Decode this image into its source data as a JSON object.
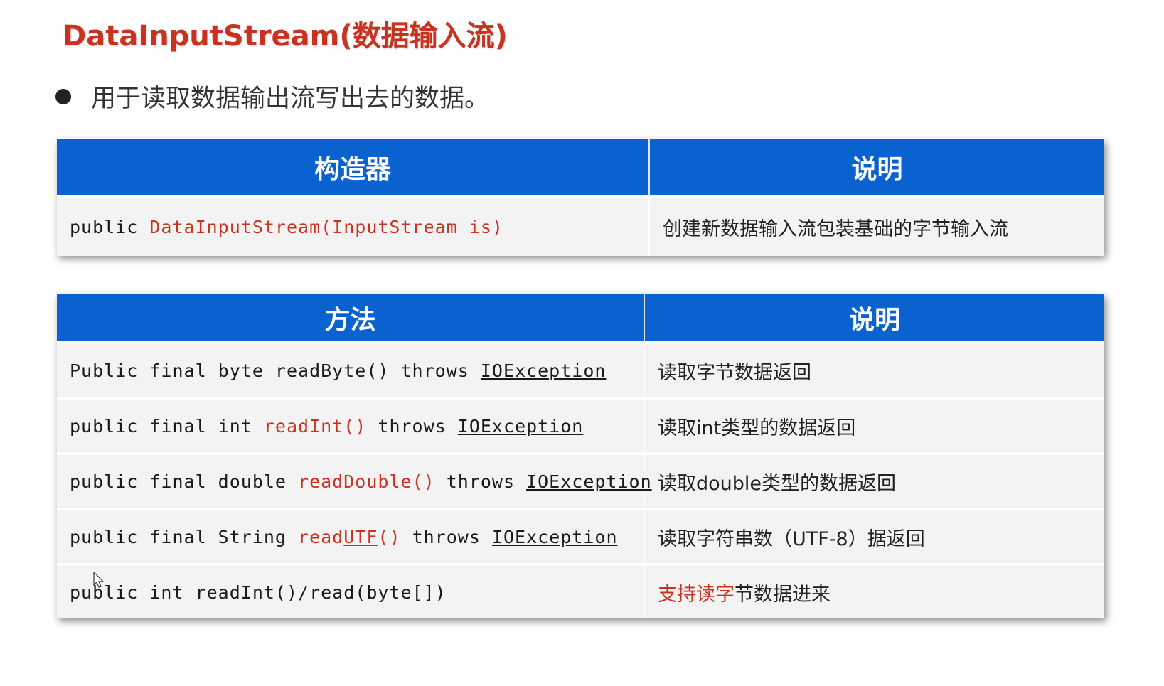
{
  "title": "DataInputStream(数据输入流)",
  "bullet": "用于读取数据输出流写出去的数据。",
  "constructor_table": {
    "headers": [
      "构造器",
      "说明"
    ],
    "rows": [
      {
        "code_plain": "public ",
        "code_red": "DataInputStream(InputStream is)",
        "desc": "创建新数据输入流包装基础的字节输入流"
      }
    ]
  },
  "method_table": {
    "headers": [
      "方法",
      "说明"
    ],
    "rows": [
      {
        "pre": "Public final byte readByte() throws ",
        "exception": "IOException",
        "desc": "读取字节数据返回"
      },
      {
        "pre": "public final int ",
        "method": "readInt()",
        "mid": " throws ",
        "exception": "IOException",
        "desc": "读取int类型的数据返回"
      },
      {
        "pre": "public final double ",
        "method": "readDouble()",
        "mid": " throws ",
        "exception": "IOException",
        "desc": "读取double类型的数据返回"
      },
      {
        "pre": "public final String ",
        "method_a": "read",
        "method_b": "UTF",
        "method_c": "()",
        "mid": " throws ",
        "exception": "IOException",
        "desc": "读取字符串数（UTF-8）据返回"
      },
      {
        "pre": "public int readInt()/read(byte[])",
        "desc_red": "支持读字",
        "desc_rest": "节数据进来"
      }
    ]
  },
  "colors": {
    "header_blue": "#0a62d0",
    "accent_red": "#c8321e"
  }
}
